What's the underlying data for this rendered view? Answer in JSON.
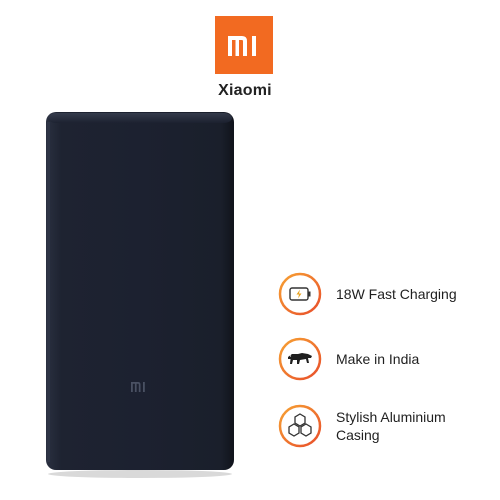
{
  "brand": {
    "logo_text": "MI",
    "name": "Xiaomi",
    "logo_color": "#f26a21"
  },
  "product": {
    "type": "power bank",
    "color": "#1b1f2a",
    "engraved_logo": "mi"
  },
  "features": [
    {
      "icon": "battery-charging-icon",
      "label": "18W Fast Charging"
    },
    {
      "icon": "make-in-india-lion-icon",
      "label": "Make in India"
    },
    {
      "icon": "hexagon-cluster-icon",
      "label_line1": "Stylish Aluminium",
      "label_line2": "Casing"
    }
  ],
  "colors": {
    "accent": "#f26a21",
    "ring_gradient_start": "#f7a233",
    "ring_gradient_end": "#e84d2a",
    "text": "#1f1f1f"
  }
}
